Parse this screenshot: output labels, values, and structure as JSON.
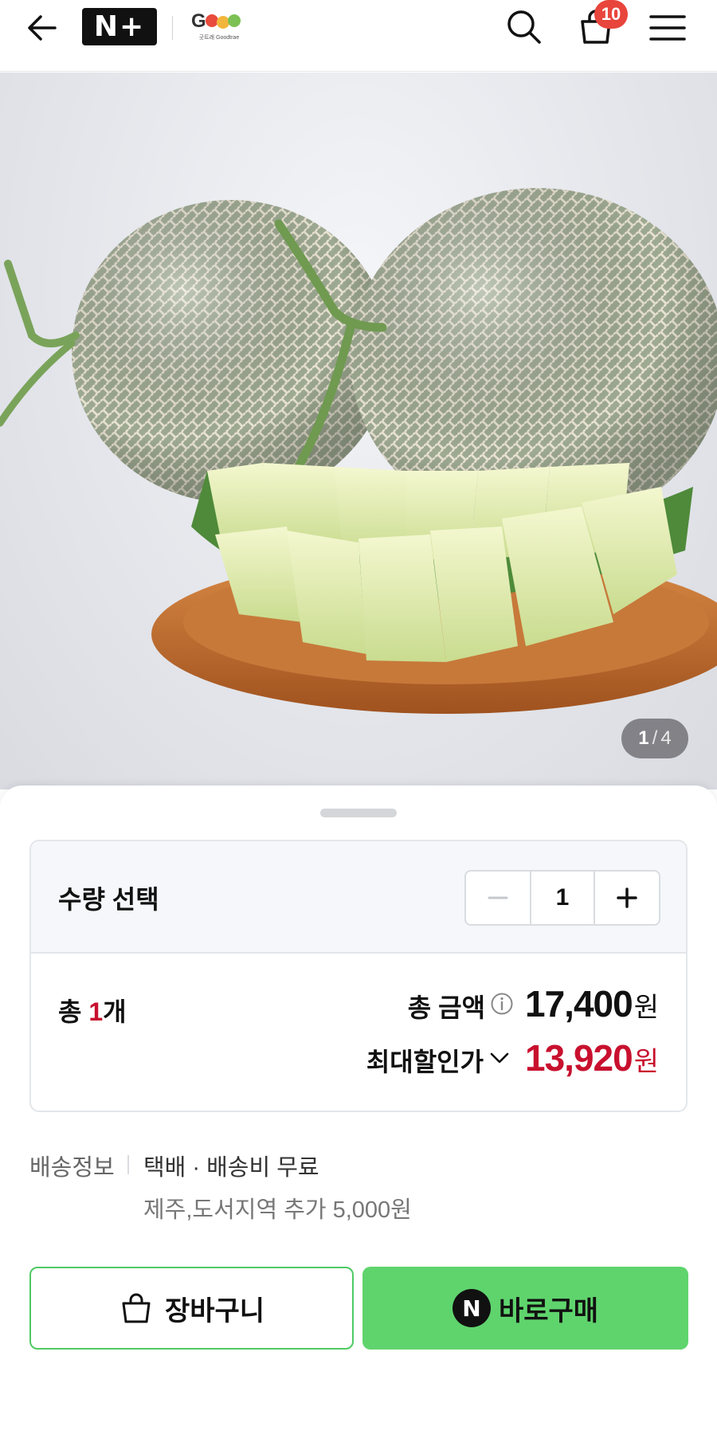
{
  "header": {
    "back_icon": "arrow-left-icon",
    "logo_text": "N+",
    "brand_name": "Goodtrae",
    "brand_caption": "굿트래 Goodtrae",
    "search_icon": "search-icon",
    "cart_icon": "shopping-bag-icon",
    "cart_count": "10",
    "menu_icon": "hamburger-menu-icon"
  },
  "gallery": {
    "current": "1",
    "separator": "/",
    "total": "4"
  },
  "option": {
    "quantity_label": "수량 선택",
    "quantity_value": "1",
    "total_prefix": "총 ",
    "total_count": "1",
    "total_suffix": "개",
    "amount_label": "총 금액",
    "amount_value": "17,400",
    "amount_unit": "원",
    "max_discount_label": "최대할인가",
    "max_discount_value": "13,920",
    "max_discount_unit": "원"
  },
  "shipping": {
    "label": "배송정보",
    "main": "택배 · 배송비 무료",
    "sub": "제주,도서지역 추가 5,000원"
  },
  "actions": {
    "cart_label": "장바구니",
    "buy_label": "바로구매",
    "buy_icon_letter": "N"
  },
  "colors": {
    "accent_green": "#5fd46d",
    "price_red": "#c8102e",
    "badge_red": "#e8453c"
  }
}
